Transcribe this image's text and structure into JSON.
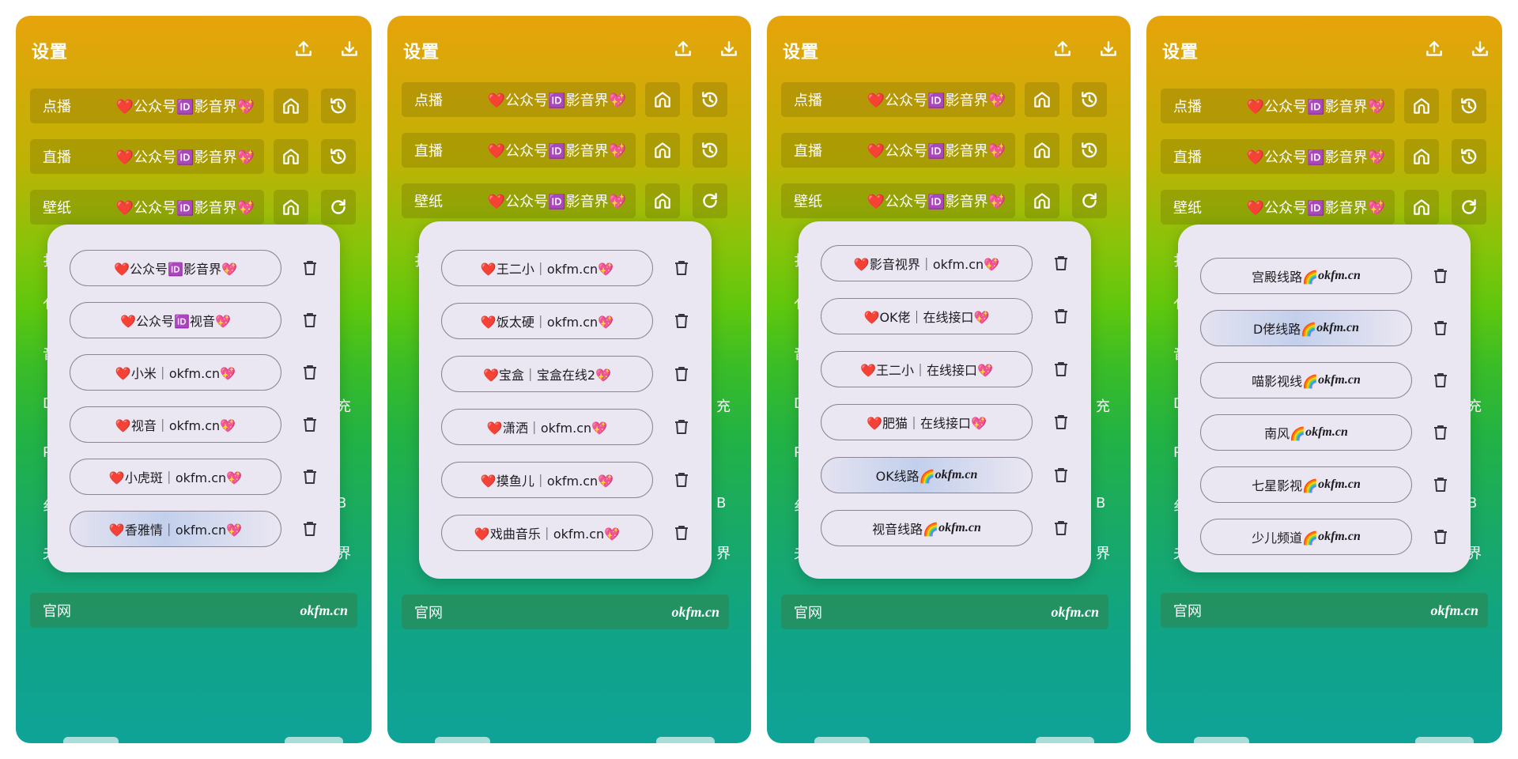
{
  "colors": {
    "accent": "#0ea397",
    "popup_bg": "#ebe7f2",
    "text_dark": "#1d1b20"
  },
  "icons": {
    "upload": "upload-icon",
    "download": "download-icon",
    "home": "home-icon",
    "history": "history-icon",
    "refresh": "refresh-icon",
    "delete": "trash-icon"
  },
  "screens": [
    {
      "title": "设置",
      "rows": [
        {
          "label": "点播",
          "value": "❤️公众号🆔影音界💖"
        },
        {
          "label": "直播",
          "value": "❤️公众号🆔影音界💖"
        },
        {
          "label": "壁纸",
          "value": "❤️公众号🆔影音界💖"
        }
      ],
      "site": {
        "label": "官网",
        "value": "okfm.cn"
      },
      "peek": [
        "扌",
        "亻",
        "音",
        "D",
        "P",
        "纟",
        "夫"
      ],
      "peek_right": [
        "充",
        "B",
        "界"
      ],
      "popup": [
        {
          "text": "❤️公众号🆔影音界💖"
        },
        {
          "text": "❤️公众号🆔视音💖"
        },
        {
          "text": "❤️小米｜okfm.cn💖"
        },
        {
          "text": "❤️视音｜okfm.cn💖"
        },
        {
          "text": "❤️小虎斑｜okfm.cn💖"
        },
        {
          "text": "❤️香雅情｜okfm.cn💖"
        }
      ]
    },
    {
      "title": "设置",
      "rows": [
        {
          "label": "点播",
          "value": "❤️公众号🆔影音界💖"
        },
        {
          "label": "直播",
          "value": "❤️公众号🆔影音界💖"
        },
        {
          "label": "壁纸",
          "value": "❤️公众号🆔影音界💖"
        }
      ],
      "site": {
        "label": "官网",
        "value": "okfm.cn"
      },
      "peek": [
        "扌"
      ],
      "peek_right": [
        "充",
        "B",
        "界"
      ],
      "popup": [
        {
          "text": "❤️王二小｜okfm.cn💖"
        },
        {
          "text": "❤️饭太硬｜okfm.cn💖"
        },
        {
          "text": "❤️宝盒｜宝盒在线2💖"
        },
        {
          "text": "❤️潇洒｜okfm.cn💖"
        },
        {
          "text": "❤️摸鱼儿｜okfm.cn💖"
        },
        {
          "text": "❤️戏曲音乐｜okfm.cn💖"
        }
      ]
    },
    {
      "title": "设置",
      "rows": [
        {
          "label": "点播",
          "value": "❤️公众号🆔影音界💖"
        },
        {
          "label": "直播",
          "value": "❤️公众号🆔影音界💖"
        },
        {
          "label": "壁纸",
          "value": "❤️公众号🆔影音界💖"
        }
      ],
      "site": {
        "label": "官网",
        "value": "okfm.cn"
      },
      "peek": [
        "扌",
        "亻",
        "音",
        "D",
        "P",
        "纟",
        "夫"
      ],
      "peek_right": [
        "充",
        "B",
        "界"
      ],
      "popup": [
        {
          "text": "❤️影音视界｜okfm.cn💖"
        },
        {
          "text": "❤️OK佬｜在线接口💖"
        },
        {
          "text": "❤️王二小｜在线接口💖"
        },
        {
          "text": "❤️肥猫｜在线接口💖"
        },
        {
          "text": "OK线路🌈",
          "brand": "okfm.cn"
        },
        {
          "text": "视音线路🌈",
          "brand": "okfm.cn"
        }
      ]
    },
    {
      "title": "设置",
      "rows": [
        {
          "label": "点播",
          "value": "❤️公众号🆔影音界💖"
        },
        {
          "label": "直播",
          "value": "❤️公众号🆔影音界💖"
        },
        {
          "label": "壁纸",
          "value": "❤️公众号🆔影音界💖"
        }
      ],
      "site": {
        "label": "官网",
        "value": "okfm.cn"
      },
      "peek": [
        "扌",
        "亻",
        "音",
        "D",
        "P",
        "纟",
        "夫"
      ],
      "peek_right": [
        "充",
        "B",
        "界"
      ],
      "popup": [
        {
          "text": "宫殿线路🌈",
          "brand": "okfm.cn"
        },
        {
          "text": "D佬线路🌈",
          "brand": "okfm.cn"
        },
        {
          "text": "喵影视线🌈",
          "brand": "okfm.cn"
        },
        {
          "text": "南风🌈",
          "brand": "okfm.cn"
        },
        {
          "text": "七星影视🌈",
          "brand": "okfm.cn"
        },
        {
          "text": "少儿频道🌈",
          "brand": "okfm.cn"
        }
      ]
    }
  ]
}
